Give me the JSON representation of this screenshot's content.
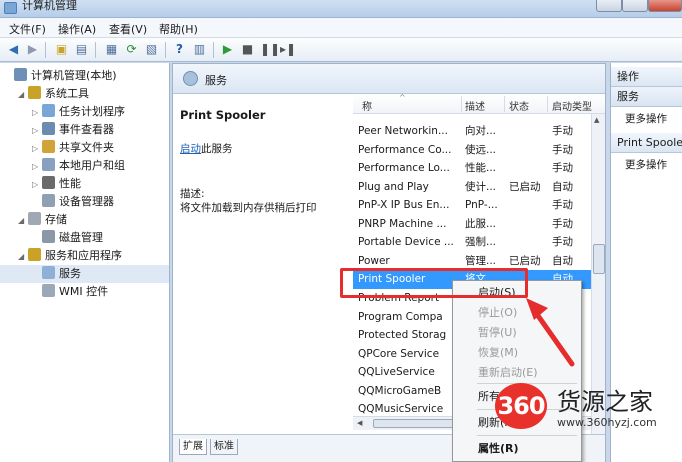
{
  "window": {
    "title": "计算机管理"
  },
  "menubar": {
    "items": [
      "文件(F)",
      "操作(A)",
      "查看(V)",
      "帮助(H)"
    ]
  },
  "tree": {
    "nodes": [
      {
        "label": "计算机管理(本地)",
        "level": 0,
        "arrow": ""
      },
      {
        "label": "系统工具",
        "level": 1,
        "arrow": "◢"
      },
      {
        "label": "任务计划程序",
        "level": 2,
        "arrow": "▷"
      },
      {
        "label": "事件查看器",
        "level": 2,
        "arrow": "▷"
      },
      {
        "label": "共享文件夹",
        "level": 2,
        "arrow": "▷"
      },
      {
        "label": "本地用户和组",
        "level": 2,
        "arrow": "▷"
      },
      {
        "label": "性能",
        "level": 2,
        "arrow": "▷"
      },
      {
        "label": "设备管理器",
        "level": 2,
        "arrow": ""
      },
      {
        "label": "存储",
        "level": 1,
        "arrow": "◢"
      },
      {
        "label": "磁盘管理",
        "level": 2,
        "arrow": ""
      },
      {
        "label": "服务和应用程序",
        "level": 1,
        "arrow": "◢"
      },
      {
        "label": "服务",
        "level": 2,
        "arrow": ""
      },
      {
        "label": "WMI 控件",
        "level": 2,
        "arrow": ""
      }
    ]
  },
  "services": {
    "header_title": "服务",
    "selected_name": "Print Spooler",
    "start_link": "启动",
    "start_link_suffix": "此服务",
    "desc_label": "描述:",
    "desc_text": "将文件加载到内存供稍后打印",
    "columns": [
      "称",
      "描述",
      "状态",
      "启动类型"
    ],
    "rows": [
      {
        "name": "Peer Networkin...",
        "desc": "向对...",
        "status": "",
        "startup": "手动"
      },
      {
        "name": "Performance Co...",
        "desc": "使远...",
        "status": "",
        "startup": "手动"
      },
      {
        "name": "Performance Lo...",
        "desc": "性能...",
        "status": "",
        "startup": "手动"
      },
      {
        "name": "Plug and Play",
        "desc": "使计...",
        "status": "已启动",
        "startup": "自动"
      },
      {
        "name": "PnP-X IP Bus En...",
        "desc": "PnP-...",
        "status": "",
        "startup": "手动"
      },
      {
        "name": "PNRP Machine ...",
        "desc": "此服...",
        "status": "",
        "startup": "手动"
      },
      {
        "name": "Portable Device ...",
        "desc": "强制...",
        "status": "",
        "startup": "手动"
      },
      {
        "name": "Power",
        "desc": "管理...",
        "status": "已启动",
        "startup": "自动"
      },
      {
        "name": "Print Spooler",
        "desc": "将文...",
        "status": "",
        "startup": "自动",
        "selected": true
      },
      {
        "name": "Problem Report",
        "desc": "",
        "status": "",
        "startup": ""
      },
      {
        "name": "Program Compa",
        "desc": "",
        "status": "",
        "startup": ""
      },
      {
        "name": "Protected Storag",
        "desc": "",
        "status": "",
        "startup": ""
      },
      {
        "name": "QPCore Service",
        "desc": "",
        "status": "",
        "startup": ""
      },
      {
        "name": "QQLiveService",
        "desc": "",
        "status": "",
        "startup": ""
      },
      {
        "name": "QQMicroGameB",
        "desc": "",
        "status": "",
        "startup": ""
      },
      {
        "name": "QQMusicService",
        "desc": "",
        "status": "",
        "startup": ""
      }
    ]
  },
  "tabs": [
    "扩展",
    "标准"
  ],
  "actions": {
    "header": "操作",
    "section1": "服务",
    "more1": "更多操作",
    "section2": "Print Spooler",
    "more2": "更多操作"
  },
  "context_menu": {
    "items": [
      {
        "label": "启动(S)",
        "disabled": false
      },
      {
        "label": "停止(O)",
        "disabled": true
      },
      {
        "label": "暂停(U)",
        "disabled": true
      },
      {
        "label": "恢复(M)",
        "disabled": true
      },
      {
        "label": "重新启动(E)",
        "disabled": true
      },
      {
        "label": "所有任务(K)",
        "disabled": false
      },
      {
        "label": "刷新(F)",
        "disabled": false
      },
      {
        "label": "属性(R)",
        "disabled": false
      }
    ]
  },
  "watermark": {
    "logo": "360",
    "title": "货源之家",
    "url": "www.360hyzj.com"
  },
  "colors": {
    "selection": "#3399ff",
    "annotation": "#e52d2d",
    "watermark": "#e8312a"
  }
}
